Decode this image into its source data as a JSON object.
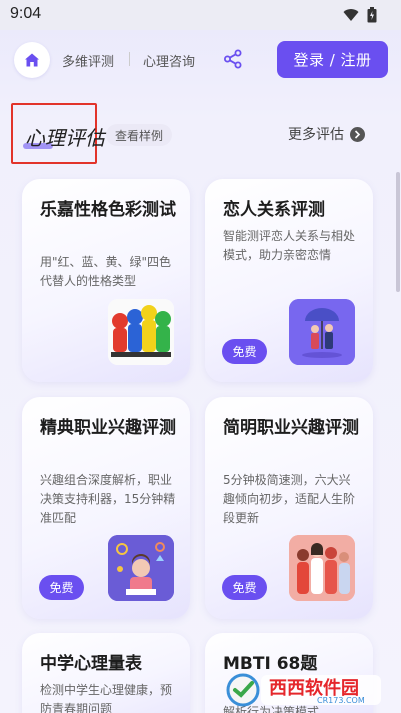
{
  "status": {
    "time": "9:04"
  },
  "nav": {
    "link_1": "多维评测",
    "link_2": "心理咨询",
    "login": "登录 / 注册"
  },
  "section": {
    "title": "心理评估",
    "sample": "查看样例",
    "more": "更多评估"
  },
  "cards": [
    {
      "title": "乐嘉性格色彩测试",
      "desc": "用\"红、蓝、黄、绿\"四色代替人的性格类型",
      "badge": ""
    },
    {
      "title": "恋人关系评测",
      "desc": "智能测评恋人关系与相处模式，助力亲密恋情",
      "badge": "免费"
    },
    {
      "title": "精典职业兴趣评测",
      "desc": "兴趣组合深度解析，职业决策支持利器，15分钟精准匹配",
      "badge": "免费"
    },
    {
      "title": "简明职业兴趣评测",
      "desc": "5分钟极简速测，六大兴趣倾向初步，适配人生阶段更新",
      "badge": "免费"
    },
    {
      "title": "中学心理量表",
      "desc": "检测中学生心理健康，预防青春期问题",
      "badge": ""
    },
    {
      "title": "MBTI 68题",
      "desc": "解析行为决策模式",
      "badge": ""
    }
  ],
  "watermark": {
    "text": "西西软件园",
    "sub": "CR173.COM"
  },
  "colors": {
    "accent": "#6a4ff0",
    "highlight_box": "#e2332a"
  }
}
